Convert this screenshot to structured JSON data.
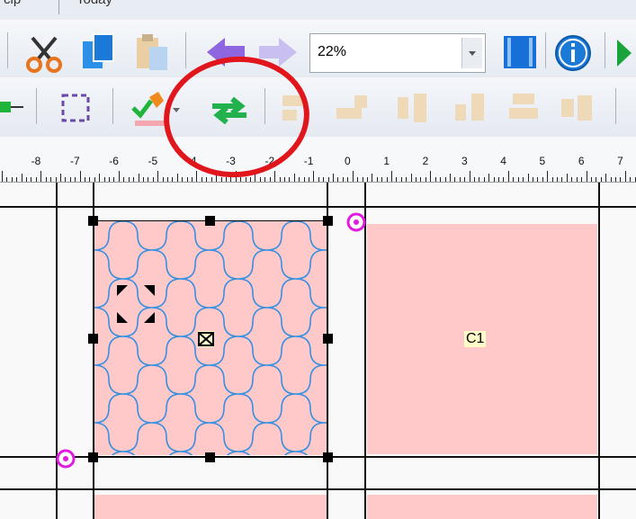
{
  "menu": {
    "left_item": "cip",
    "right_item": "Today"
  },
  "toolbar": {
    "zoom_value": "22%",
    "icons": [
      "scissors-icon",
      "copy-icon",
      "paste-icon",
      "undo-arrow-icon",
      "redo-arrow-icon",
      "filmstrip-icon",
      "info-icon",
      "play-icon",
      "node-icon",
      "select-frame-icon",
      "color-tool-icon",
      "swap-icon",
      "align-left-icon",
      "align-bottom-left-icon",
      "align-top-icon",
      "align-bottom-icon",
      "align-center-icon",
      "align-right-icon"
    ]
  },
  "ruler": {
    "labels": [
      "-8",
      "-7",
      "-6",
      "-5",
      "-4",
      "-3",
      "-2",
      "-1",
      "0",
      "1",
      "2",
      "3",
      "4",
      "5",
      "6",
      "7"
    ]
  },
  "canvas": {
    "selected_block_label": "",
    "block_label": "C1"
  },
  "colors": {
    "block_fill": "#ffc9ca",
    "pattern_stroke": "#3a8fe0",
    "rotate_handle": "#e21be1",
    "annotation_circle": "#e0161c",
    "swap_icon": "#22b14c"
  }
}
